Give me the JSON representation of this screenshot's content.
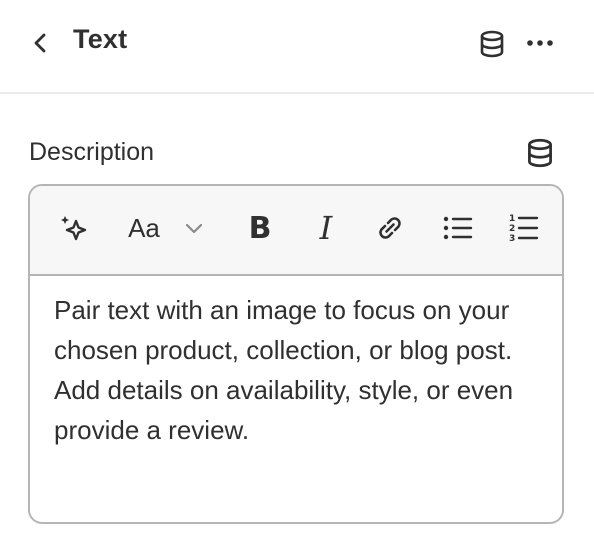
{
  "header": {
    "title": "Text",
    "back_icon": "chevron-left-icon",
    "dynamic_source_icon": "database-icon",
    "more_icon": "more-horizontal-icon"
  },
  "field": {
    "label": "Description",
    "dynamic_source_icon": "database-icon"
  },
  "toolbar": {
    "items": [
      "sparkle-ai-icon",
      "text-format-icon",
      "chevron-down-icon",
      "bold-icon",
      "italic-icon",
      "link-icon",
      "bulleted-list-icon",
      "numbered-list-icon"
    ],
    "text_format_label": "Aa",
    "bold_label": "B",
    "italic_label": "I"
  },
  "editor": {
    "content": "Pair text with an image to focus on your chosen product, collection, or blog post. Add details on availability, style, or even provide a review."
  },
  "colors": {
    "text": "#303030",
    "border": "#b5b5b5",
    "toolbar_bg": "#f7f7f7",
    "divider": "#ebebeb"
  }
}
